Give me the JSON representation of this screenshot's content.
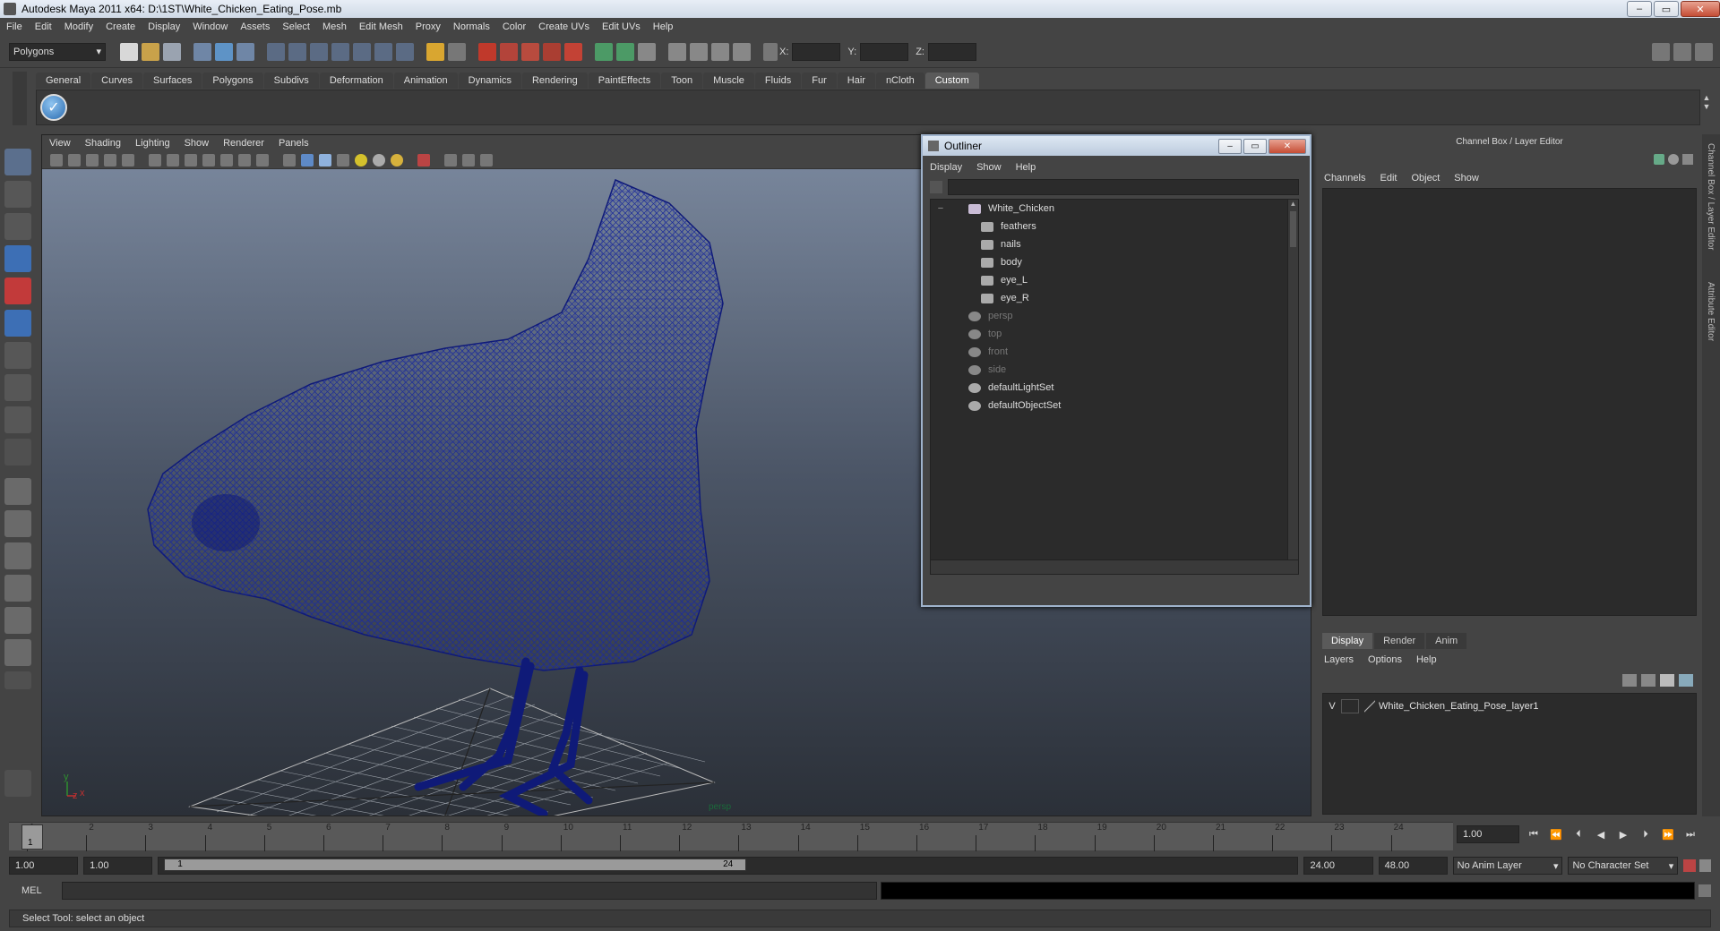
{
  "title_bar": {
    "title": "Autodesk Maya 2011 x64: D:\\1ST\\White_Chicken_Eating_Pose.mb"
  },
  "menu_bar": {
    "items": [
      "File",
      "Edit",
      "Modify",
      "Create",
      "Display",
      "Window",
      "Assets",
      "Select",
      "Mesh",
      "Edit Mesh",
      "Proxy",
      "Normals",
      "Color",
      "Create UVs",
      "Edit UVs",
      "Help"
    ]
  },
  "status_line": {
    "mode": "Polygons",
    "x_label": "X:",
    "y_label": "Y:",
    "z_label": "Z:"
  },
  "shelf": {
    "tabs": [
      "General",
      "Curves",
      "Surfaces",
      "Polygons",
      "Subdivs",
      "Deformation",
      "Animation",
      "Dynamics",
      "Rendering",
      "PaintEffects",
      "Toon",
      "Muscle",
      "Fluids",
      "Fur",
      "Hair",
      "nCloth",
      "Custom"
    ],
    "active_tab": "Custom"
  },
  "viewport": {
    "menu": [
      "View",
      "Shading",
      "Lighting",
      "Show",
      "Renderer",
      "Panels"
    ],
    "camera_label": "persp",
    "axis_y": "y",
    "axis_x": "x",
    "axis_z": "z",
    "wire_color": "#0f1a78"
  },
  "outliner": {
    "title": "Outliner",
    "menu": [
      "Display",
      "Show",
      "Help"
    ],
    "tree": [
      {
        "label": "White_Chicken",
        "indent": 0,
        "dim": false,
        "expand": "−"
      },
      {
        "label": "feathers",
        "indent": 1,
        "dim": false,
        "expand": ""
      },
      {
        "label": "nails",
        "indent": 1,
        "dim": false,
        "expand": ""
      },
      {
        "label": "body",
        "indent": 1,
        "dim": false,
        "expand": ""
      },
      {
        "label": "eye_L",
        "indent": 1,
        "dim": false,
        "expand": ""
      },
      {
        "label": "eye_R",
        "indent": 1,
        "dim": false,
        "expand": ""
      },
      {
        "label": "persp",
        "indent": 0,
        "dim": true,
        "expand": ""
      },
      {
        "label": "top",
        "indent": 0,
        "dim": true,
        "expand": ""
      },
      {
        "label": "front",
        "indent": 0,
        "dim": true,
        "expand": ""
      },
      {
        "label": "side",
        "indent": 0,
        "dim": true,
        "expand": ""
      },
      {
        "label": "defaultLightSet",
        "indent": 0,
        "dim": false,
        "expand": ""
      },
      {
        "label": "defaultObjectSet",
        "indent": 0,
        "dim": false,
        "expand": ""
      }
    ]
  },
  "channel_box": {
    "title": "Channel Box / Layer Editor",
    "menu": [
      "Channels",
      "Edit",
      "Object",
      "Show"
    ],
    "side_tabs": [
      "Channel Box / Layer Editor",
      "Attribute Editor"
    ]
  },
  "layer_editor": {
    "tabs": [
      "Display",
      "Render",
      "Anim"
    ],
    "active_tab": "Display",
    "menu": [
      "Layers",
      "Options",
      "Help"
    ],
    "layers": [
      {
        "visible": "V",
        "name": "White_Chicken_Eating_Pose_layer1"
      }
    ]
  },
  "time_slider": {
    "ticks": [
      "1",
      "2",
      "3",
      "4",
      "5",
      "6",
      "7",
      "8",
      "9",
      "10",
      "11",
      "12",
      "13",
      "14",
      "15",
      "16",
      "17",
      "18",
      "19",
      "20",
      "21",
      "22",
      "23",
      "24"
    ],
    "current_frame": "1",
    "current_time": "1.00"
  },
  "range_slider": {
    "start_time": "1.00",
    "playback_start": "1.00",
    "range_start": "1",
    "range_end": "24",
    "playback_end": "24.00",
    "end_time": "48.00",
    "anim_layer": "No Anim Layer",
    "character_set": "No Character Set"
  },
  "command_line": {
    "label": "MEL"
  },
  "help_line": {
    "text": "Select Tool: select an object"
  }
}
